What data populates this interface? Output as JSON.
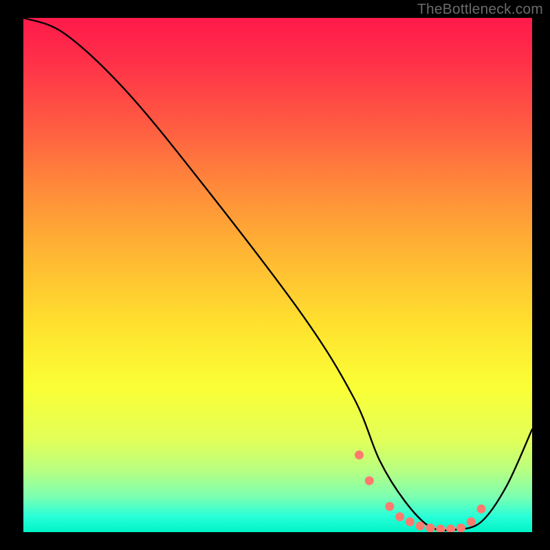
{
  "watermark": "TheBottleneck.com",
  "chart_data": {
    "type": "line",
    "title": "",
    "xlabel": "",
    "ylabel": "",
    "xlim": [
      0,
      100
    ],
    "ylim": [
      0,
      100
    ],
    "series": [
      {
        "name": "curve",
        "x": [
          0,
          8,
          20,
          35,
          55,
          65,
          70,
          75,
          80,
          85,
          90,
          95,
          100
        ],
        "values": [
          100,
          97,
          86,
          68,
          42,
          26,
          14,
          6,
          1,
          0.5,
          2,
          9,
          20
        ]
      }
    ],
    "markers": {
      "name": "dots",
      "color": "#ff7a6e",
      "x": [
        66,
        68,
        72,
        74,
        76,
        78,
        80,
        82,
        84,
        86,
        88,
        90
      ],
      "values": [
        15,
        10,
        5,
        3,
        2,
        1.2,
        0.8,
        0.6,
        0.6,
        0.8,
        2,
        4.5
      ]
    }
  }
}
